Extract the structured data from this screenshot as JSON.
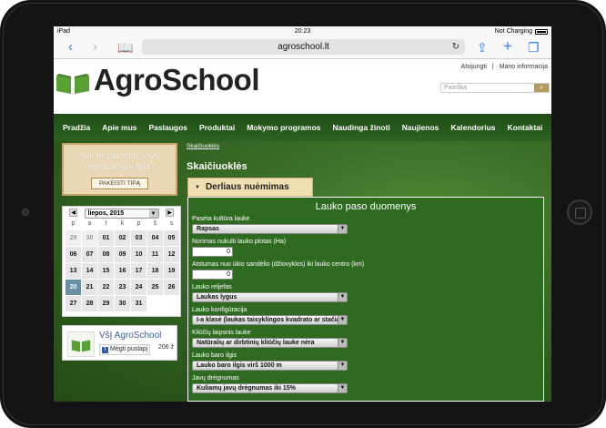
{
  "statusbar": {
    "device": "iPad",
    "time": "20:23",
    "charging": "Not Charging"
  },
  "browser": {
    "url": "agroschool.lt"
  },
  "header": {
    "logo_text": "AgroSchool",
    "toplinks": [
      "Atsijungti",
      "|",
      "Mano informacija"
    ],
    "search_placeholder": "Paieška"
  },
  "nav": {
    "items": [
      "Pradžia",
      "Apie mus",
      "Paslaugos",
      "Produktai",
      "Mokymo programos",
      "Naudinga žinoti",
      "Naujienos",
      "Kalendorius",
      "Kontaktai"
    ]
  },
  "registration": {
    "text_line1": "Norite pakeisti savo",
    "text_line2": "registracijos tipą?",
    "button": "PAKEISTI TIPĄ"
  },
  "calendar": {
    "month": "liepos, 2015",
    "day_headers": [
      "p",
      "a",
      "t",
      "k",
      "p",
      "š",
      "s"
    ],
    "days": [
      [
        "29",
        "30",
        "01",
        "02",
        "03",
        "04",
        "05"
      ],
      [
        "06",
        "07",
        "08",
        "09",
        "10",
        "11",
        "12"
      ],
      [
        "13",
        "14",
        "15",
        "16",
        "17",
        "18",
        "19"
      ],
      [
        "20",
        "21",
        "22",
        "23",
        "24",
        "25",
        "26"
      ],
      [
        "27",
        "28",
        "29",
        "30",
        "31",
        "",
        ""
      ]
    ],
    "today": "20"
  },
  "facebook": {
    "page_name": "VšĮ AgroSchool",
    "like": "Mėgti puslapį",
    "count": "206 ž"
  },
  "main": {
    "breadcrumb": "Skaičiuoklės",
    "title": "Skaičiuoklės",
    "accordion": "Derliaus nuėmimas",
    "panel_title": "Lauko paso duomenys",
    "fields": {
      "crop_label": "Pasėta kultūra lauke",
      "crop_value": "Rapsas",
      "area_label": "Norimas nukulti lauko plotas (Ha)",
      "area_value": "0",
      "distance_label": "Atstumas nuo ūkio sandėlio (džiovyklos) iki lauko centro (km)",
      "distance_value": "0",
      "relief_label": "Lauko reljefas",
      "relief_value": "Laukas lygus",
      "config_label": "Lauko konfigūracija",
      "config_value": "I-a klasė (laukas taisyklingos kvadrato ar stačiak",
      "obstacle_label": "Kliūčių laipsnis lauke",
      "obstacle_value": "Natūralių ar dirbtinių kliūčių lauke nėra",
      "edge_label": "Lauko baro ilgis",
      "edge_value": "Lauko baro ilgis virš 1000 m",
      "moisture_label": "Javų drėgnumas",
      "moisture_value": "Kuliamų javų drėgnumas iki 15%"
    }
  },
  "colors": {
    "nav_green": "#2d6221",
    "accent_tan": "#e9d7b6",
    "ios_blue": "#2f7cf6"
  }
}
